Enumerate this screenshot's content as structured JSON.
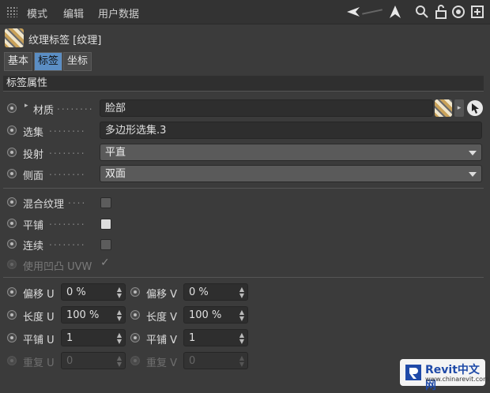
{
  "menubar": {
    "items": [
      "模式",
      "编辑",
      "用户数据"
    ],
    "icons": [
      "arrow-left-icon",
      "arrow-up-icon",
      "search-icon",
      "lock-icon",
      "target-icon",
      "new-window-icon"
    ]
  },
  "header": {
    "title": "纹理标签 [纹理]",
    "tabs": [
      "基本",
      "标签",
      "坐标"
    ],
    "active_tab": "标签"
  },
  "section": {
    "title": "标签属性"
  },
  "props": {
    "material": {
      "label": "材质",
      "dots": "........",
      "value": "脸部"
    },
    "selection": {
      "label": "选集",
      "dots": "........",
      "value": "多边形选集.3"
    },
    "projection": {
      "label": "投射",
      "dots": "........",
      "value": "平直"
    },
    "side": {
      "label": "侧面",
      "dots": "........",
      "value": "双面"
    },
    "mix": {
      "label": "混合纹理",
      "dots": "....",
      "checked": false
    },
    "tile": {
      "label": "平铺",
      "dots": "........",
      "checked": true
    },
    "seamless": {
      "label": "连续",
      "dots": "........",
      "checked": false
    },
    "bump_uvw": {
      "label": "使用凹凸 UVW",
      "checked": true
    }
  },
  "offsets": {
    "offset_u": {
      "label": "偏移 U",
      "value": "0 %"
    },
    "offset_v": {
      "label": "偏移 V",
      "value": "0 %"
    },
    "length_u": {
      "label": "长度 U",
      "value": "100 %"
    },
    "length_v": {
      "label": "长度 V",
      "value": "100 %"
    },
    "tiles_u": {
      "label": "平铺 U",
      "value": "1"
    },
    "tiles_v": {
      "label": "平铺 V",
      "value": "1"
    },
    "repeat_u": {
      "label": "重复 U",
      "value": "0"
    },
    "repeat_v": {
      "label": "重复 V",
      "value": "0"
    }
  },
  "watermark": {
    "brand": "Revit中文网",
    "url": "www.chinarevit.com"
  },
  "colors": {
    "accent": "#5b8ec4",
    "panel": "#3b3b3b"
  }
}
